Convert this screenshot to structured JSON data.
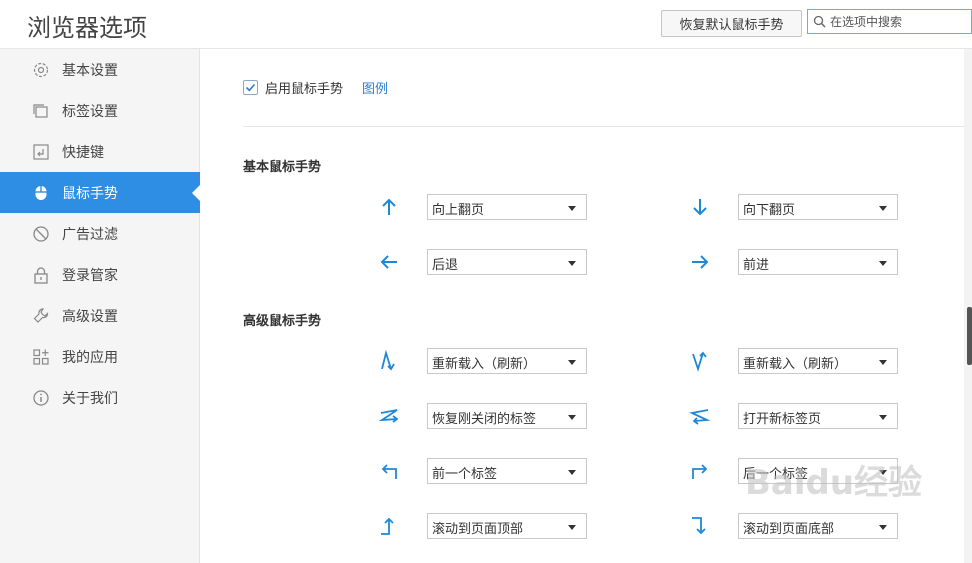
{
  "app_title": "浏览器选项",
  "restore_button": "恢复默认鼠标手势",
  "search": {
    "placeholder": "在选项中搜索"
  },
  "sidebar": {
    "items": [
      {
        "label": "基本设置",
        "icon": "gear-icon"
      },
      {
        "label": "标签设置",
        "icon": "tab-icon"
      },
      {
        "label": "快捷键",
        "icon": "keyboard-icon"
      },
      {
        "label": "鼠标手势",
        "icon": "mouse-icon",
        "active": true
      },
      {
        "label": "广告过滤",
        "icon": "block-icon"
      },
      {
        "label": "登录管家",
        "icon": "lock-icon"
      },
      {
        "label": "高级设置",
        "icon": "wrench-icon"
      },
      {
        "label": "我的应用",
        "icon": "apps-icon"
      },
      {
        "label": "关于我们",
        "icon": "info-icon"
      }
    ]
  },
  "enable": {
    "label": "启用鼠标手势",
    "checked": true,
    "example_link": "图例"
  },
  "basic": {
    "title": "基本鼠标手势",
    "rows": [
      {
        "left_icon": "arrow-up-icon",
        "left_value": "向上翻页",
        "right_icon": "arrow-down-icon",
        "right_value": "向下翻页"
      },
      {
        "left_icon": "arrow-left-icon",
        "left_value": "后退",
        "right_icon": "arrow-right-icon",
        "right_value": "前进"
      }
    ]
  },
  "advanced": {
    "title": "高级鼠标手势",
    "rows": [
      {
        "left_icon": "gesture-up-down-icon",
        "left_value": "重新载入（刷新）",
        "right_icon": "gesture-down-up-icon",
        "right_value": "重新载入（刷新）"
      },
      {
        "left_icon": "gesture-right-left-icon",
        "left_value": "恢复刚关闭的标签",
        "right_icon": "gesture-left-right-icon",
        "right_value": "打开新标签页"
      },
      {
        "left_icon": "gesture-up-left-icon",
        "left_value": "前一个标签",
        "right_icon": "gesture-up-right-icon",
        "right_value": "后一个标签"
      },
      {
        "left_icon": "gesture-left-up-icon",
        "left_value": "滚动到页面顶部",
        "right_icon": "gesture-right-down-icon",
        "right_value": "滚动到页面底部"
      }
    ]
  },
  "colors": {
    "accent": "#2e8ee3",
    "link": "#2e7cd1"
  },
  "watermark": "Baidu经验"
}
